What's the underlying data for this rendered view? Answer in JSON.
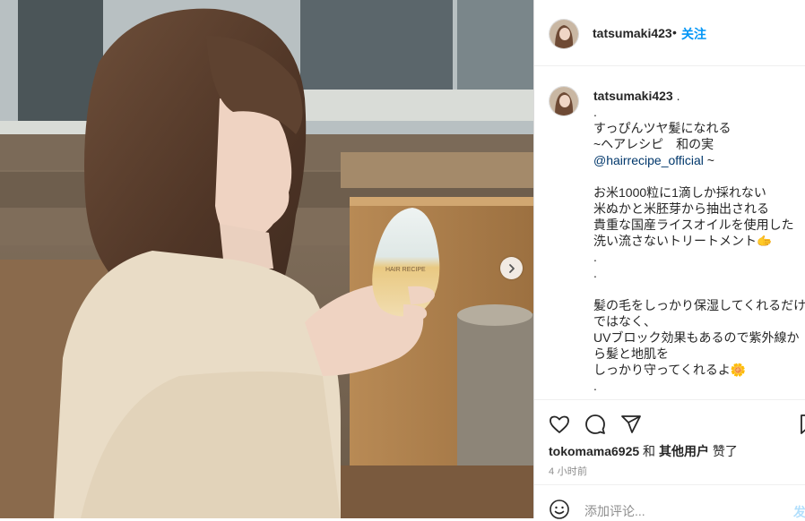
{
  "post": {
    "username": "tatsumaki423",
    "follow_separator": "•",
    "follow_label": "关注",
    "caption_username": "tatsumaki423",
    "caption_lines": [
      ".",
      "すっぴんツヤ髪になれる",
      "~ヘアレシピ　和の実",
      "",
      "",
      "お米1000粒に1滴しか採れない",
      "米ぬかと米胚芽から抽出される",
      "貴重な国産ライスオイルを使用した",
      "洗い流さないトリートメント🫱",
      ".",
      ".",
      "",
      "髪の毛をしっかり保湿してくれるだけ",
      "ではなく、",
      "UVブロック効果もあるので紫外線か",
      "ら髪と地肌を",
      "しっかり守ってくれるよ🌼",
      "."
    ],
    "caption_mention": "@hairrecipe_official",
    "caption_mention_suffix": " ~",
    "caption_dot": ".",
    "likes_user": "tokomama6925",
    "likes_and": " 和 ",
    "likes_others": "其他用户",
    "likes_suffix": " 赞了",
    "time": "4 小时前",
    "comment_placeholder": "添加评论...",
    "post_label": "发"
  },
  "product_label": "HAIR RECIPE",
  "icons": {
    "like": "heart-icon",
    "comment": "comment-icon",
    "share": "share-icon",
    "save": "bookmark-icon",
    "emoji": "emoji-icon",
    "next": "chevron-right-icon"
  },
  "colors": {
    "link": "#00376b",
    "follow": "#0095f6",
    "post_disabled": "#b2dffc"
  }
}
